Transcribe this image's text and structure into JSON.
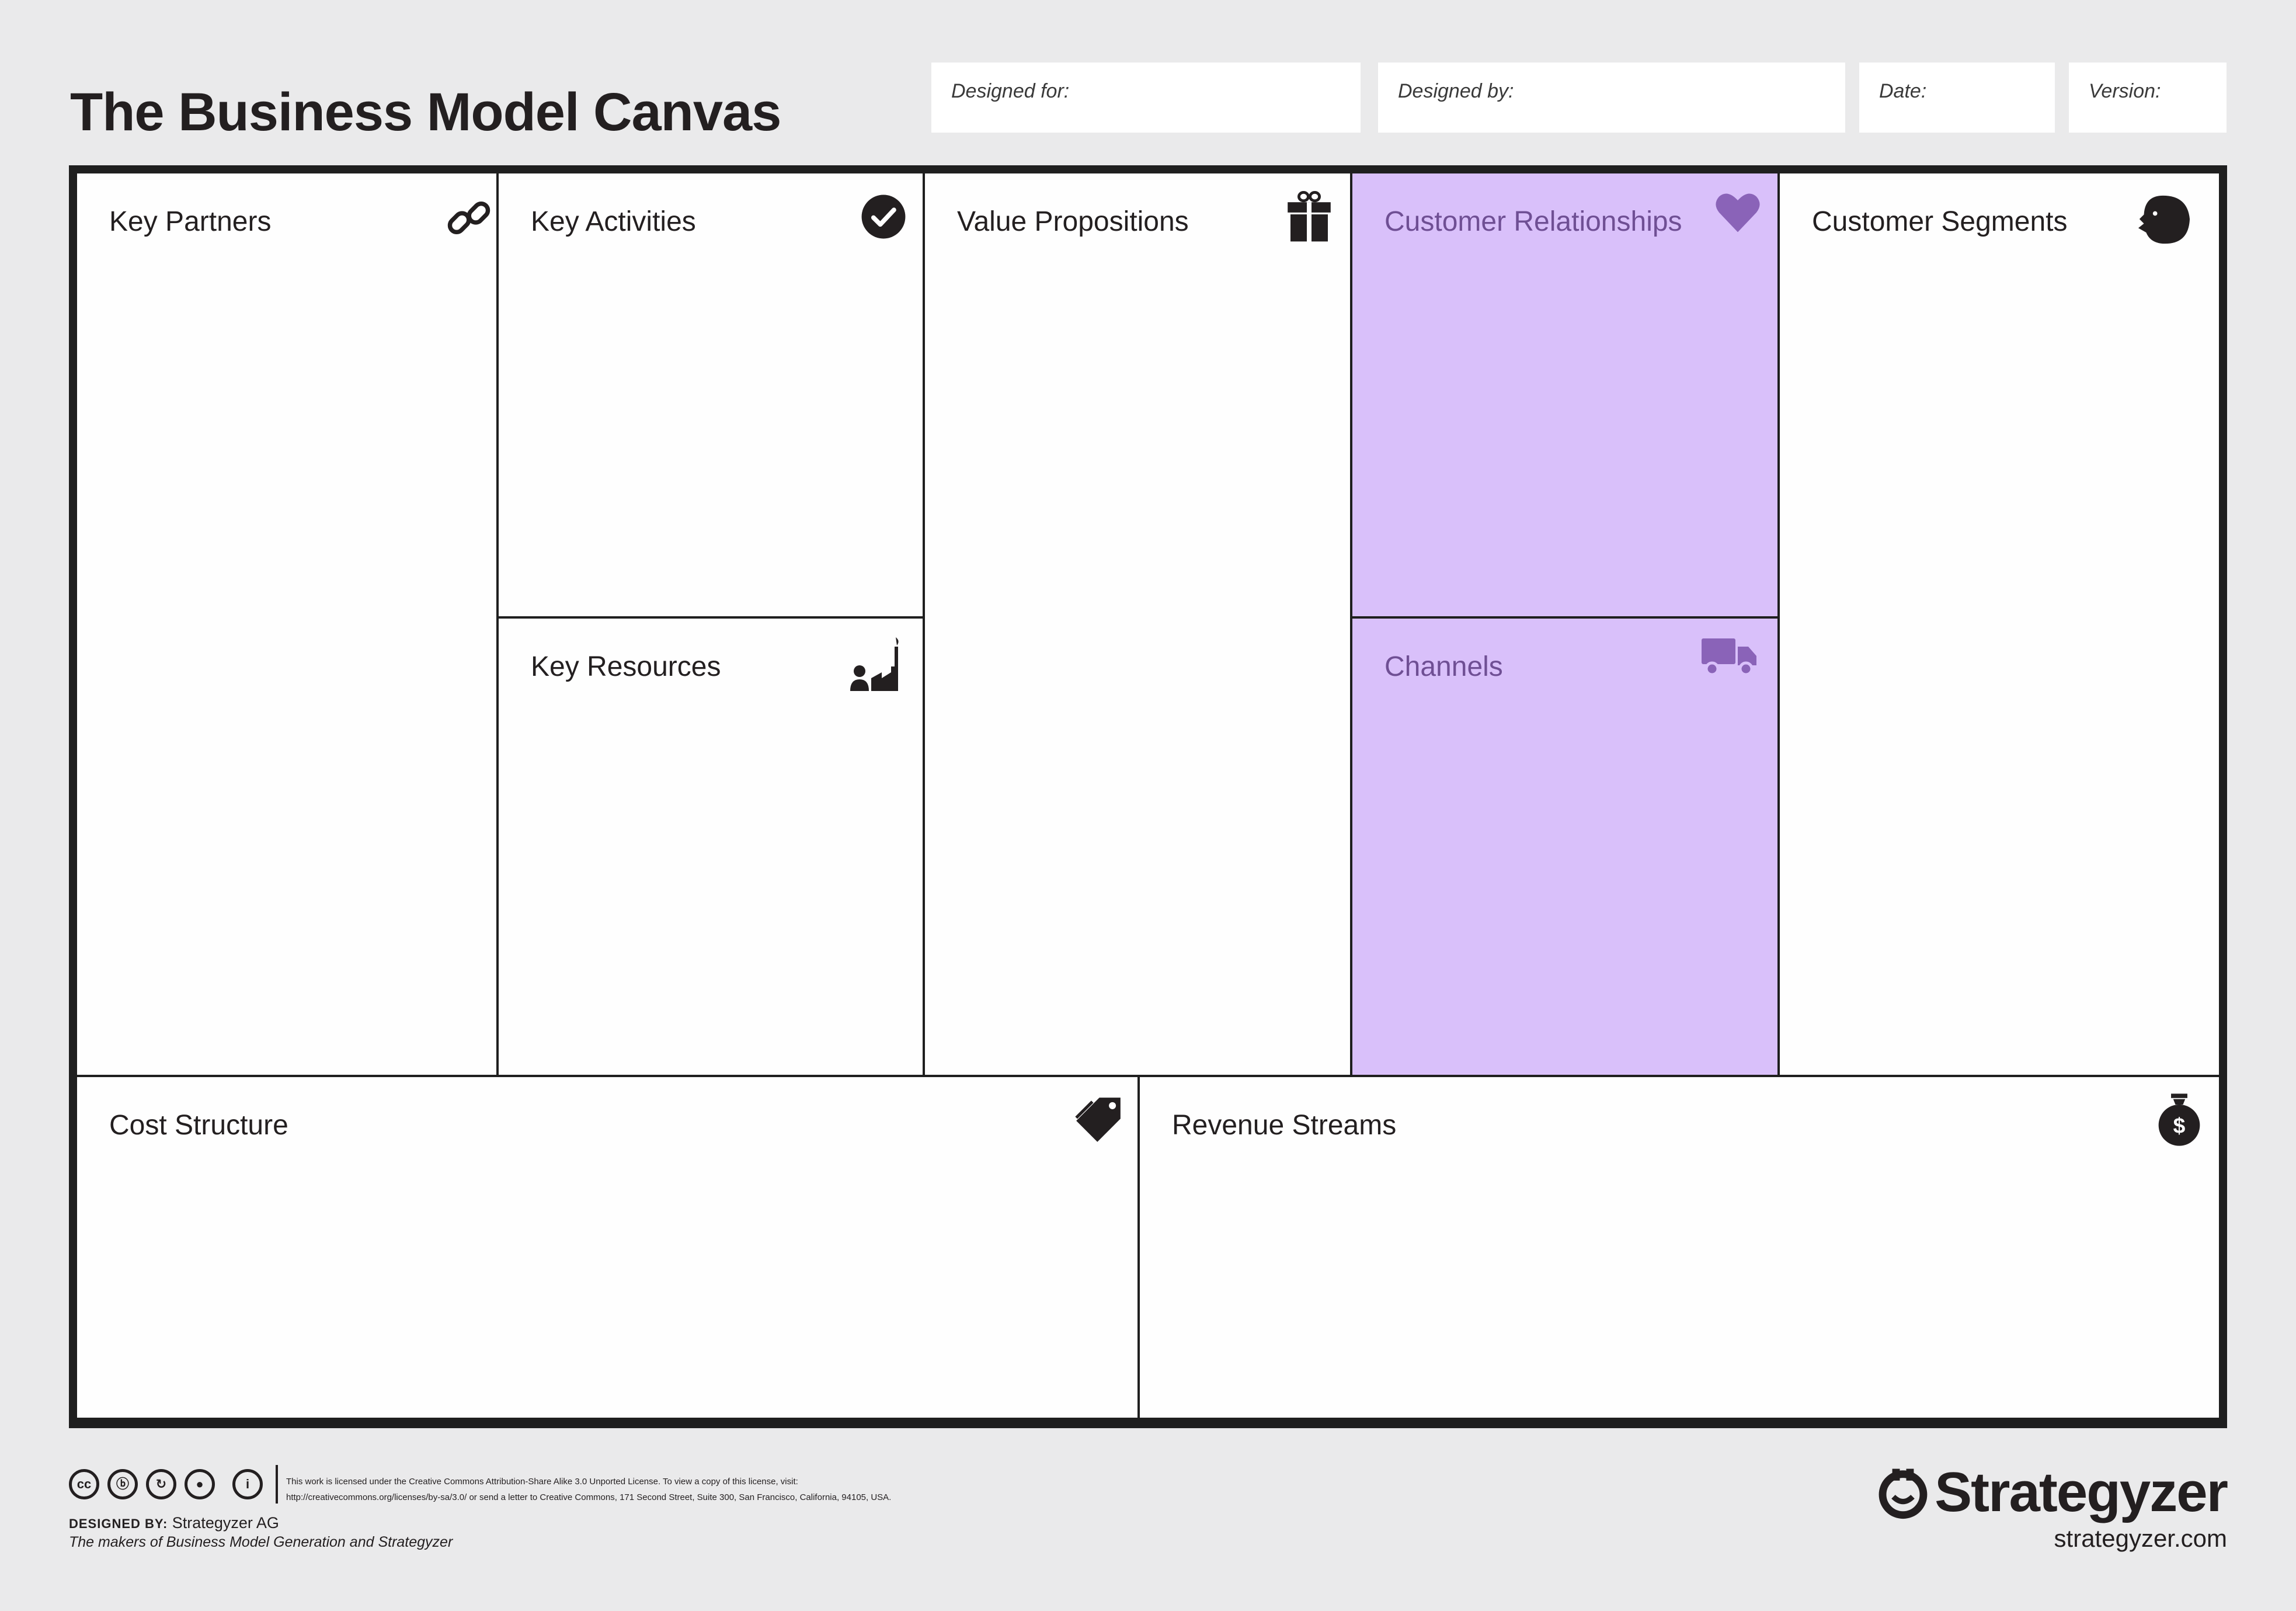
{
  "header": {
    "title": "The Business Model Canvas",
    "designed_for_label": "Designed for:",
    "designed_by_label": "Designed by:",
    "date_label": "Date:",
    "version_label": "Version:"
  },
  "blocks": {
    "key_partners": {
      "label": "Key Partners",
      "icon": "link-icon"
    },
    "key_activities": {
      "label": "Key Activities",
      "icon": "checkmark-circle-icon"
    },
    "key_resources": {
      "label": "Key Resources",
      "icon": "factory-worker-icon"
    },
    "value_propositions": {
      "label": "Value Propositions",
      "icon": "gift-icon"
    },
    "customer_relationships": {
      "label": "Customer Relationships",
      "icon": "heart-icon",
      "highlight": "#d9c0fa"
    },
    "channels": {
      "label": "Channels",
      "icon": "truck-icon",
      "highlight": "#d9c0fa"
    },
    "customer_segments": {
      "label": "Customer Segments",
      "icon": "face-profile-icon"
    },
    "cost_structure": {
      "label": "Cost Structure",
      "icon": "price-tag-icon"
    },
    "revenue_streams": {
      "label": "Revenue Streams",
      "icon": "money-bag-icon"
    }
  },
  "footer": {
    "license_line1": "This work is licensed under the Creative Commons Attribution-Share Alike 3.0 Unported License. To view a copy of this license, visit:",
    "license_line2": "http://creativecommons.org/licenses/by-sa/3.0/ or send a letter to Creative Commons, 171 Second Street, Suite 300, San Francisco, California, 94105, USA.",
    "designed_by_prefix": "DESIGNED BY:",
    "designed_by_value": "Strategyzer AG",
    "makers": "The makers of Business Model Generation and Strategyzer",
    "brand": "Strategyzer",
    "brand_url": "strategyzer.com",
    "cc_icons": [
      "cc",
      "by",
      "sa",
      "nc",
      "i"
    ]
  },
  "colors": {
    "highlight": "#d9c0fa",
    "highlight_text": "#6f4f94",
    "background": "#eaeaeb",
    "border": "#1f1f1f"
  }
}
